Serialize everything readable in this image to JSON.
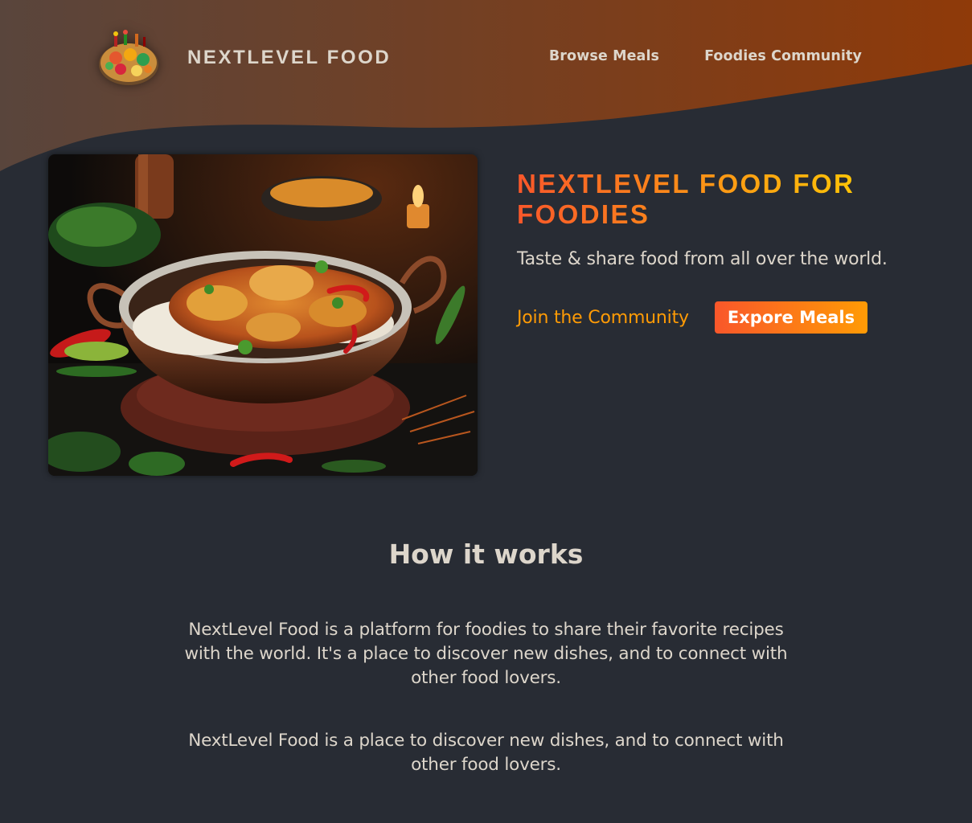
{
  "brand": {
    "name": "NEXTLEVEL FOOD",
    "logo_icon": "food-platter-icon"
  },
  "nav": {
    "items": [
      {
        "label": "Browse Meals"
      },
      {
        "label": "Foodies Community"
      }
    ]
  },
  "hero": {
    "image_icon": "curry-dish-image",
    "title": "NEXTLEVEL FOOD FOR FOODIES",
    "subtitle": "Taste & share food from all over the world.",
    "join_link": "Join the Community",
    "explore_button": "Expore Meals"
  },
  "how": {
    "title": "How it works",
    "paragraph1": "NextLevel Food is a platform for foodies to share their favorite recipes with the world. It's a place to discover new dishes, and to connect with other food lovers.",
    "paragraph2": "NextLevel Food is a place to discover new dishes, and to connect with other food lovers."
  },
  "colors": {
    "background": "#282c34",
    "text": "#ddd6cb",
    "accent_start": "#f9572a",
    "accent_mid": "#ff9b05",
    "accent_end": "#ffc905",
    "header_wave_start": "#59453c",
    "header_wave_end": "#8f3a09"
  }
}
